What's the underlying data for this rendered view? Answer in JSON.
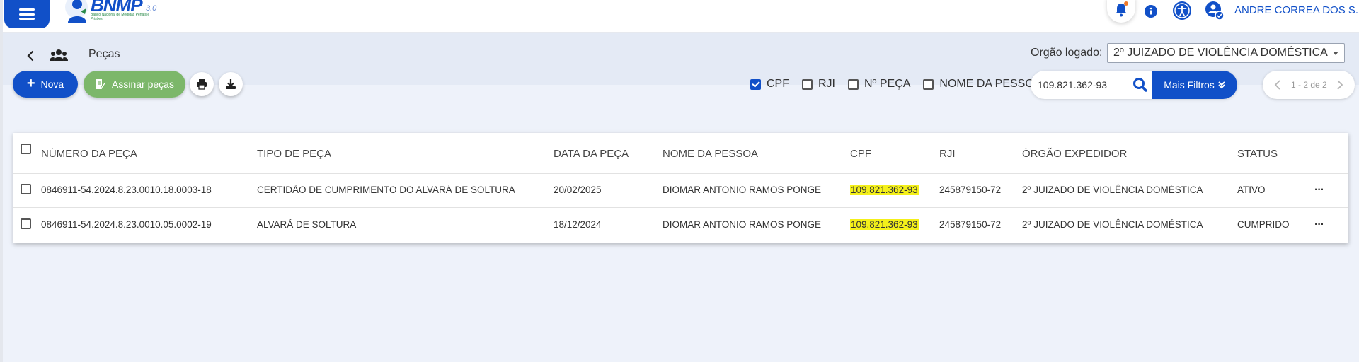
{
  "app": {
    "logo_text": "BNMP",
    "logo_version": "3.0",
    "logo_subtitle": "Banco Nacional de Medidas Penais e Prisões",
    "user_name": "ANDRE CORREA DOS S...",
    "accent_color": "#1150c8",
    "success_color": "#7cb76a",
    "highlight_color": "#f4f01a"
  },
  "header": {
    "page_title": "Peças",
    "orgao_label": "Orgão logado:",
    "orgao_value": "2º JUIZADO DE VIOLÊNCIA DOMÉSTICA"
  },
  "toolbar": {
    "nova_label": "Nova",
    "assinar_label": "Assinar peças"
  },
  "filters": {
    "options": [
      {
        "label": "CPF",
        "checked": true
      },
      {
        "label": "RJI",
        "checked": false
      },
      {
        "label": "Nº PEÇA",
        "checked": false
      },
      {
        "label": "NOME DA PESSOA",
        "checked": false
      }
    ],
    "search_value": "109.821.362-93",
    "mais_filtros_label": "Mais Filtros"
  },
  "pager": {
    "text": "1 - 2 de 2"
  },
  "table": {
    "headers": [
      "NÚMERO DA PEÇA",
      "TIPO DE PEÇA",
      "DATA DA PEÇA",
      "NOME DA PESSOA",
      "CPF",
      "RJI",
      "ÓRGÃO EXPEDIDOR",
      "STATUS"
    ],
    "rows": [
      {
        "numero": "0846911-54.2024.8.23.0010.18.0003-18",
        "tipo": "CERTIDÃO DE CUMPRIMENTO DO ALVARÁ DE SOLTURA",
        "data": "20/02/2025",
        "nome": "DIOMAR ANTONIO RAMOS PONGE",
        "cpf": "109.821.362-93",
        "rji": "245879150-72",
        "orgao": "2º JUIZADO DE VIOLÊNCIA DOMÉSTICA",
        "status": "ATIVO"
      },
      {
        "numero": "0846911-54.2024.8.23.0010.05.0002-19",
        "tipo": "ALVARÁ DE SOLTURA",
        "data": "18/12/2024",
        "nome": "DIOMAR ANTONIO RAMOS PONGE",
        "cpf": "109.821.362-93",
        "rji": "245879150-72",
        "orgao": "2º JUIZADO DE VIOLÊNCIA DOMÉSTICA",
        "status": "CUMPRIDO"
      }
    ]
  }
}
